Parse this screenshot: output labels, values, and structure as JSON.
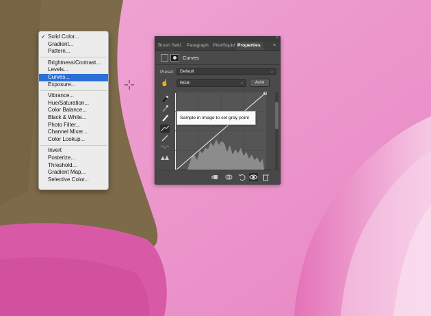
{
  "menu": {
    "items": [
      {
        "label": "Solid Color...",
        "checked": true
      },
      {
        "label": "Gradient..."
      },
      {
        "label": "Pattern..."
      },
      {
        "label": "Brightness/Contrast..."
      },
      {
        "label": "Levels..."
      },
      {
        "label": "Curves...",
        "selected": true
      },
      {
        "label": "Exposure..."
      },
      {
        "label": "Vibrance..."
      },
      {
        "label": "Hue/Saturation..."
      },
      {
        "label": "Color Balance..."
      },
      {
        "label": "Black & White..."
      },
      {
        "label": "Photo Filter..."
      },
      {
        "label": "Channel Mixer..."
      },
      {
        "label": "Color Lookup..."
      },
      {
        "label": "Invert"
      },
      {
        "label": "Posterize..."
      },
      {
        "label": "Threshold..."
      },
      {
        "label": "Gradient Map..."
      },
      {
        "label": "Selective Color..."
      }
    ],
    "check_glyph": "✓"
  },
  "panel": {
    "close_glyph": "×",
    "tabs": [
      "Brush Setti",
      "Paragraph",
      "PixelSquid",
      "Properties"
    ],
    "active_tab": "Properties",
    "menu_glyph": "≡",
    "header_title": "Curves",
    "preset_label": "Preset:",
    "preset_value": "Default",
    "channel_value": "RGB",
    "auto_label": "Auto",
    "tooltip": "Sample in image to set gray point"
  },
  "colors": {
    "selection": "#2d6fd8",
    "panel_bg": "#4a4a4a",
    "background_pink": "#ea8ec8",
    "background_olive": "#7d6a48"
  },
  "icons": {
    "tools": [
      "target-adjust-icon",
      "eyedropper-black-icon",
      "eyedropper-gray-icon",
      "eyedropper-white-icon",
      "curve-points-icon",
      "pencil-icon",
      "smooth-icon",
      "clipping-warning-icon"
    ],
    "footer": [
      "clip-to-layer-icon",
      "view-previous-icon",
      "reset-icon",
      "visibility-eye-icon",
      "trash-icon"
    ]
  }
}
